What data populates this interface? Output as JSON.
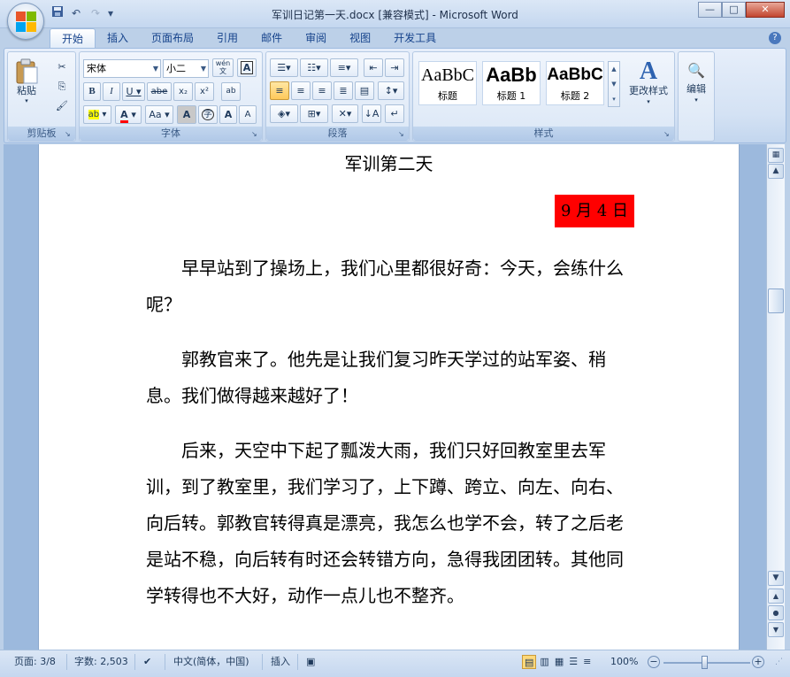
{
  "window": {
    "title": "军训日记第一天.docx [兼容模式] - Microsoft Word",
    "controls": {
      "minimize": "—",
      "maximize": "□",
      "close": "✕"
    }
  },
  "qat": {
    "save": "💾",
    "undo": "↶",
    "redo": "↷",
    "customize": "▾"
  },
  "ribbon": {
    "tabs": [
      "开始",
      "插入",
      "页面布局",
      "引用",
      "邮件",
      "审阅",
      "视图",
      "开发工具"
    ],
    "active_tab": "开始",
    "help": "?",
    "clipboard": {
      "label": "剪贴板",
      "paste": "粘贴",
      "cut": "✂",
      "copy": "⎘",
      "format_painter": "🖌"
    },
    "font": {
      "label": "字体",
      "font_name": "宋体",
      "font_size": "小二",
      "phonetic": "wén 文",
      "char_border": "A",
      "bold": "B",
      "italic": "I",
      "underline": "U",
      "strike": "abe",
      "subscript": "x₂",
      "superscript": "x²",
      "clear": "ab",
      "highlight": "ab",
      "font_color": "A",
      "change_case": "Aa",
      "char_shading": "A",
      "enclose": "字",
      "grow": "A",
      "shrink": "A"
    },
    "paragraph": {
      "label": "段落"
    },
    "styles": {
      "label": "样式",
      "items": [
        {
          "sample": "AaBbC",
          "name": "标题"
        },
        {
          "sample": "AaBb",
          "name": "标题 1"
        },
        {
          "sample": "AaBbC",
          "name": "标题 2"
        }
      ],
      "change_styles": "更改样式"
    },
    "editing": {
      "label": "编辑"
    }
  },
  "document": {
    "title": "军训第二天",
    "date": "9 月 4 日",
    "paragraphs": [
      "早早站到了操场上，我们心里都很好奇：今天，会练什么呢？",
      "郭教官来了。他先是让我们复习昨天学过的站军姿、稍息。我们做得越来越好了！",
      "后来，天空中下起了瓢泼大雨，我们只好回教室里去军训，到了教室里，我们学习了，上下蹲、跨立、向左、向右、向后转。郭教官转得真是漂亮，我怎么也学不会，转了之后老是站不稳，向后转有时还会转错方向，急得我团团转。其他同学转得也不大好，动作一点儿也不整齐。"
    ]
  },
  "status": {
    "page": "页面: 3/8",
    "words": "字数: 2,503",
    "language": "中文(简体，中国)",
    "mode": "插入",
    "zoom": "100%"
  },
  "colors": {
    "date_highlight": "#ff0000",
    "accent": "#15428b"
  }
}
